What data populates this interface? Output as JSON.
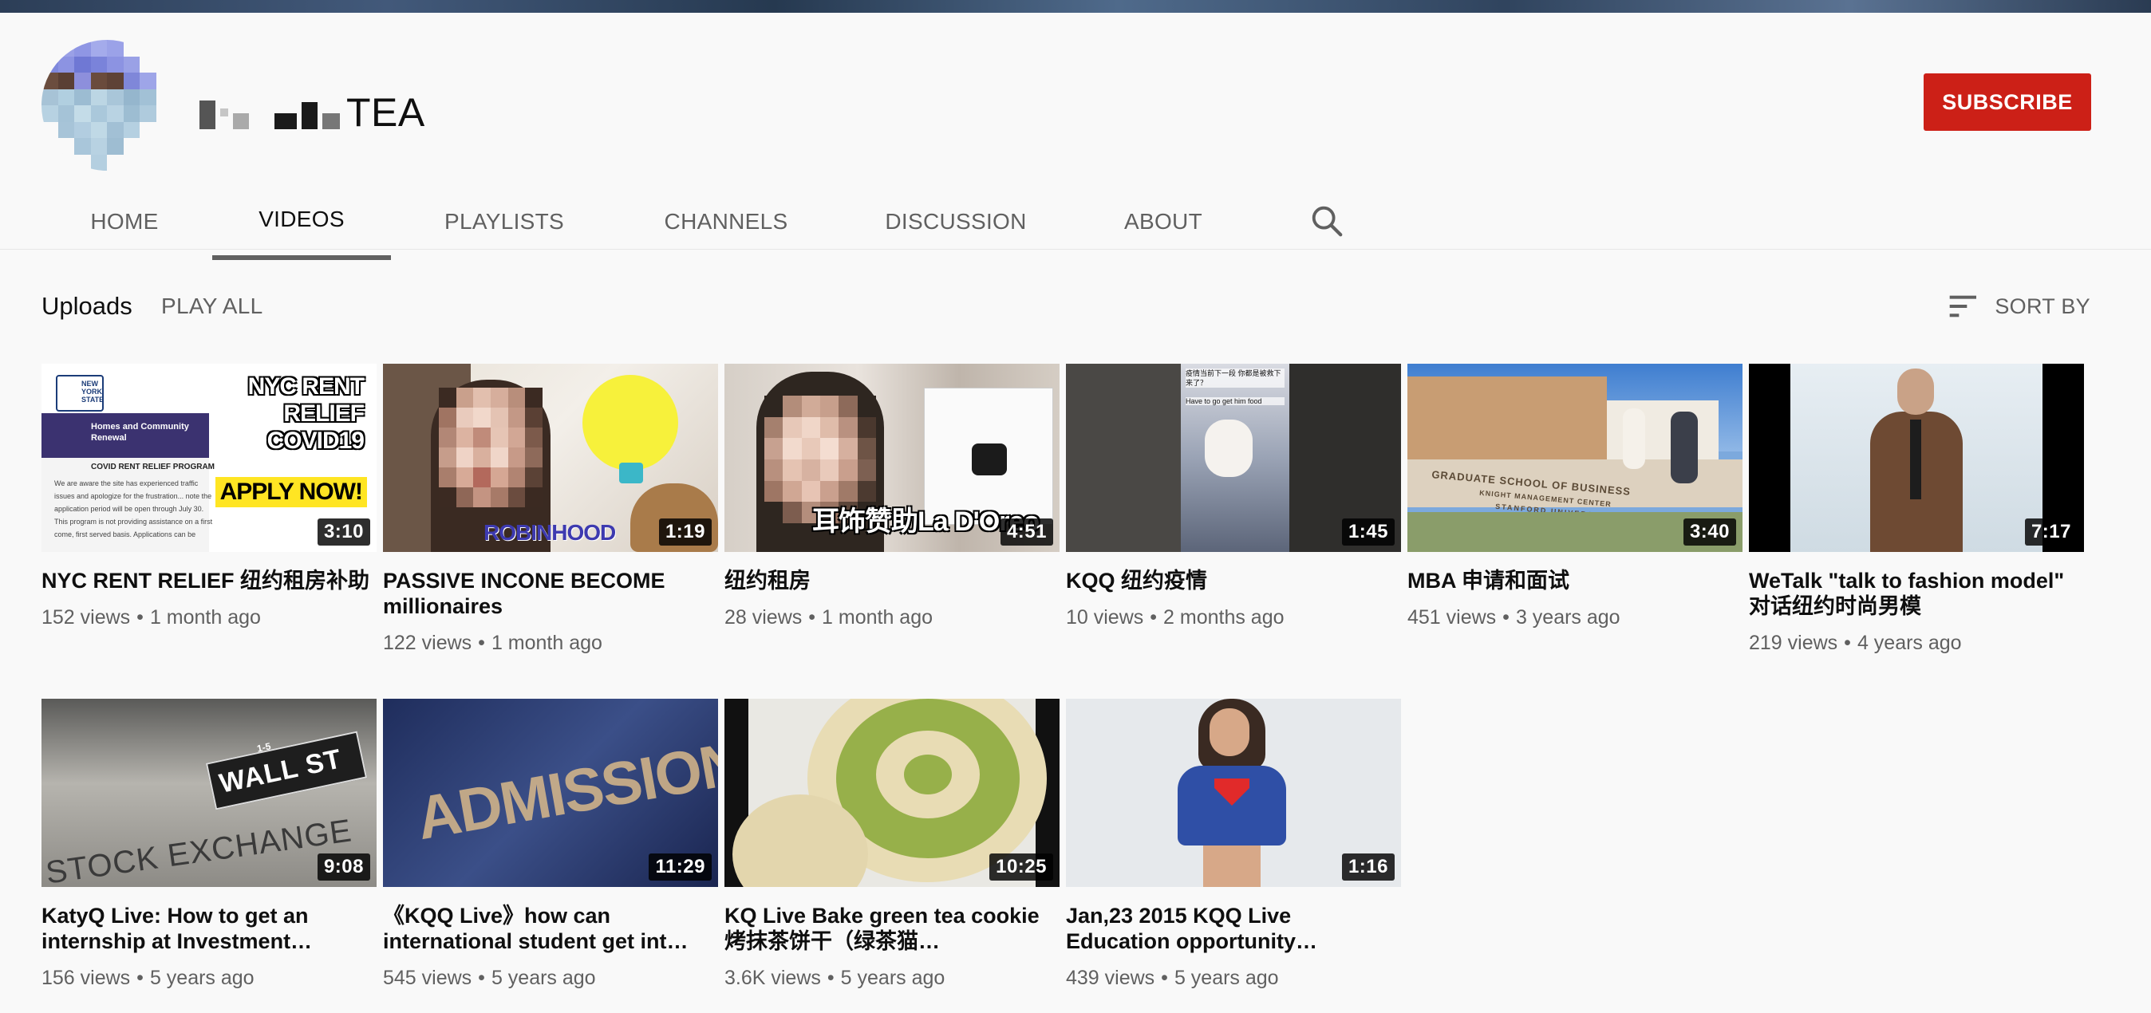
{
  "channel": {
    "name": "TEA",
    "subscribe_label": "SUBSCRIBE"
  },
  "tabs": [
    {
      "label": "HOME"
    },
    {
      "label": "VIDEOS"
    },
    {
      "label": "PLAYLISTS"
    },
    {
      "label": "CHANNELS"
    },
    {
      "label": "DISCUSSION"
    },
    {
      "label": "ABOUT"
    }
  ],
  "active_tab": "VIDEOS",
  "icons": {
    "search": "search-icon",
    "sort": "sort-icon"
  },
  "uploads": {
    "title": "Uploads",
    "play_all": "PLAY ALL",
    "sort_by": "SORT BY"
  },
  "colors": {
    "subscribe": "#cc2017",
    "background": "#f9f9f9",
    "secondary_text": "#606060"
  },
  "videos": [
    {
      "title": "NYC RENT RELIEF 纽约租房补助",
      "views": "152 views",
      "age": "1 month ago",
      "duration": "3:10",
      "thumb_text": {
        "state": "NEW YORK STATE",
        "agency": "Homes and Community Renewal",
        "program": "COVID RENT RELIEF PROGRAM",
        "body": "We are aware the site has experienced traffic issues and apologize for the frustration... note the application period will be open through July 30. This program is not providing assistance on a first come, first served basis. Applications can be",
        "headline": "NYC RENT RELIEF COVID19",
        "cta": "APPLY NOW!"
      }
    },
    {
      "title": "PASSIVE INCONE BECOME millionaires",
      "views": "122 views",
      "age": "1 month ago",
      "duration": "1:19",
      "thumb_text": {
        "caption": "ROBINHOOD"
      }
    },
    {
      "title": "纽约租房",
      "views": "28 views",
      "age": "1 month ago",
      "duration": "4:51",
      "thumb_text": {
        "caption": "耳饰赞助La D'Oreo"
      }
    },
    {
      "title": "KQQ 纽约疫情",
      "views": "10 views",
      "age": "2 months ago",
      "duration": "1:45",
      "thumb_text": {
        "caption_cn": "疫情当前下一段 你都是被救下来了？",
        "caption_en": "Have to go get him food"
      }
    },
    {
      "title": "MBA 申请和面试",
      "views": "451 views",
      "age": "3 years ago",
      "duration": "3:40",
      "thumb_text": {
        "sign_main": "GRADUATE SCHOOL OF BUSINESS",
        "sign_sub": "KNIGHT MANAGEMENT CENTER",
        "sign_uni": "STANFORD UNIVERSITY"
      }
    },
    {
      "title": "WeTalk \"talk to fashion model\" 对话纽约时尚男模",
      "views": "219 views",
      "age": "4 years ago",
      "duration": "7:17"
    },
    {
      "title": "KatyQ Live: How to get an internship at Investment…",
      "views": "156 views",
      "age": "5 years ago",
      "duration": "9:08",
      "thumb_text": {
        "street_sign": "WALL ST",
        "street_num": "1-5",
        "facade": "STOCK EXCHANGE"
      }
    },
    {
      "title": "《KQQ Live》how can international student get int…",
      "views": "545 views",
      "age": "5 years ago",
      "duration": "11:29",
      "thumb_text": {
        "word": "ADMISSION"
      }
    },
    {
      "title": "KQ Live Bake green tea cookie 烤抹茶饼干（绿茶猫…",
      "views": "3.6K views",
      "age": "5 years ago",
      "duration": "10:25"
    },
    {
      "title": "Jan,23 2015 KQQ Live Education opportunity…",
      "views": "439 views",
      "age": "5 years ago",
      "duration": "1:16"
    }
  ]
}
